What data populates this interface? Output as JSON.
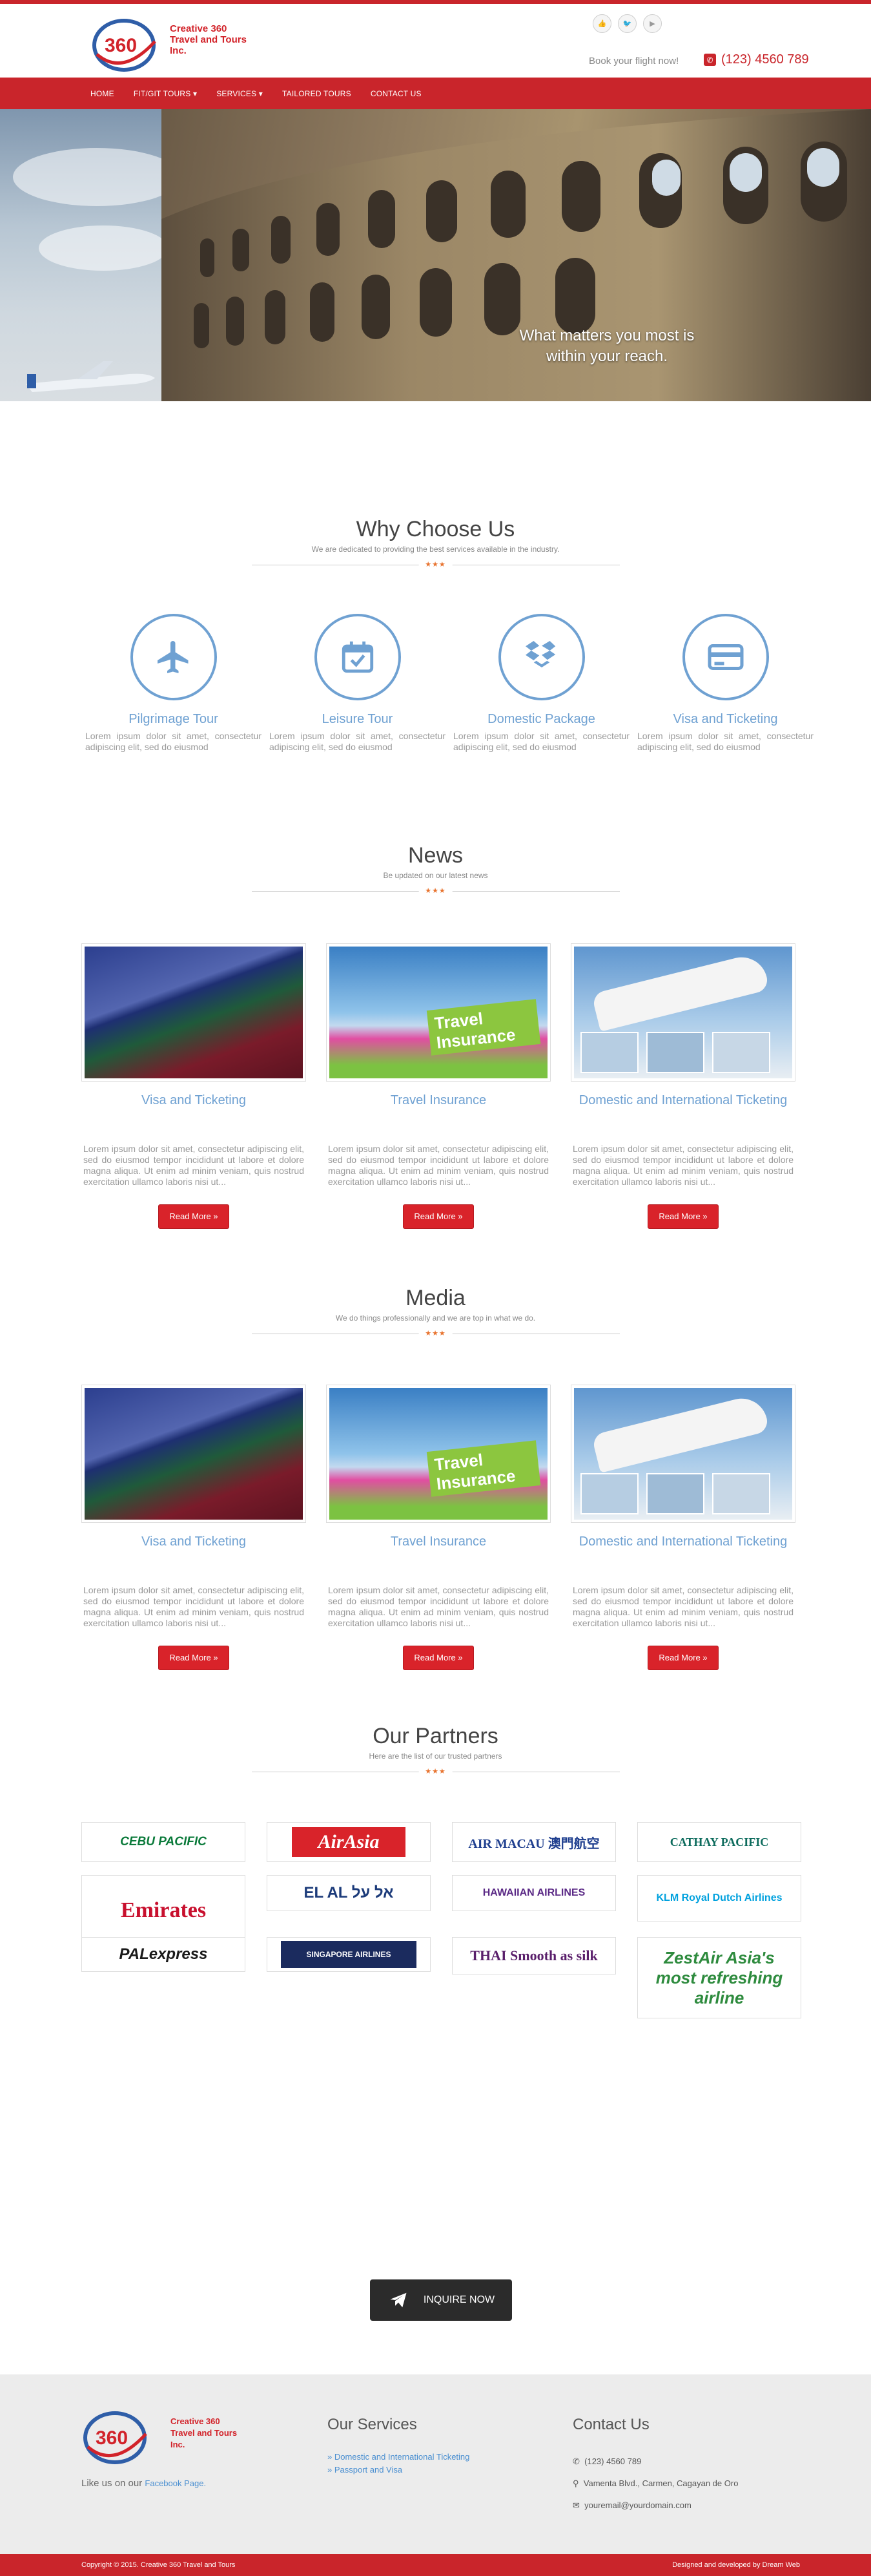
{
  "brand": {
    "name_line1": "Creative 360",
    "name_line2": "Travel and Tours",
    "name_line3": "Inc.",
    "logo_number": "360"
  },
  "header": {
    "book_text": "Book your flight now!",
    "phone": "(123) 4560 789",
    "social": [
      "thumbs-up-icon",
      "twitter-icon",
      "youtube-icon"
    ]
  },
  "nav": [
    "HOME",
    "FIT/GIT TOURS ▾",
    "SERVICES ▾",
    "TAILORED TOURS",
    "CONTACT US"
  ],
  "hero": {
    "tagline": "What matters you most is within your reach."
  },
  "why": {
    "title": "Why Choose Us",
    "subtitle": "We are dedicated to providing the best services available in the industry.",
    "features": [
      {
        "icon": "airplane-icon",
        "title": "Pilgrimage Tour",
        "text": "Lorem ipsum dolor sit amet, consectetur adipiscing elit, sed do eiusmod"
      },
      {
        "icon": "calendar-check-icon",
        "title": "Leisure Tour",
        "text": "Lorem ipsum dolor sit amet, consectetur adipiscing elit, sed do eiusmod"
      },
      {
        "icon": "dropbox-icon",
        "title": "Domestic Package",
        "text": "Lorem ipsum dolor sit amet, consectetur adipiscing elit, sed do eiusmod"
      },
      {
        "icon": "credit-card-icon",
        "title": "Visa and Ticketing",
        "text": "Lorem ipsum dolor sit amet, consectetur adipiscing elit, sed do eiusmod"
      }
    ]
  },
  "news": {
    "title": "News",
    "subtitle": "Be updated on our latest news",
    "items": [
      {
        "title": "Visa and Ticketing",
        "image": "passports",
        "text": "Lorem ipsum dolor sit amet, consectetur adipiscing elit, sed do eiusmod tempor incididunt ut labore et dolore magna aliqua. Ut enim ad minim veniam, quis nostrud exercitation ullamco laboris nisi ut...",
        "button": "Read More »"
      },
      {
        "title": "Travel Insurance",
        "image": "travel-insurance",
        "text": "Lorem ipsum dolor sit amet, consectetur adipiscing elit, sed do eiusmod tempor incididunt ut labore et dolore magna aliqua. Ut enim ad minim veniam, quis nostrud exercitation ullamco laboris nisi ut...",
        "button": "Read More »"
      },
      {
        "title": "Domestic and International Ticketing",
        "image": "airplanes",
        "text": "Lorem ipsum dolor sit amet, consectetur adipiscing elit, sed do eiusmod tempor incididunt ut labore et dolore magna aliqua. Ut enim ad minim veniam, quis nostrud exercitation ullamco laboris nisi ut...",
        "button": "Read More »"
      }
    ]
  },
  "media": {
    "title": "Media",
    "subtitle": "We do things professionally and we are top in what we do.",
    "items": [
      {
        "title": "Visa and Ticketing",
        "image": "passports",
        "text": "Lorem ipsum dolor sit amet, consectetur adipiscing elit, sed do eiusmod tempor incididunt ut labore et dolore magna aliqua. Ut enim ad minim veniam, quis nostrud exercitation ullamco laboris nisi ut...",
        "button": "Read More »"
      },
      {
        "title": "Travel Insurance",
        "image": "travel-insurance",
        "text": "Lorem ipsum dolor sit amet, consectetur adipiscing elit, sed do eiusmod tempor incididunt ut labore et dolore magna aliqua. Ut enim ad minim veniam, quis nostrud exercitation ullamco laboris nisi ut...",
        "button": "Read More »"
      },
      {
        "title": "Domestic and International Ticketing",
        "image": "airplanes",
        "text": "Lorem ipsum dolor sit amet, consectetur adipiscing elit, sed do eiusmod tempor incididunt ut labore et dolore magna aliqua. Ut enim ad minim veniam, quis nostrud exercitation ullamco laboris nisi ut...",
        "button": "Read More »"
      }
    ]
  },
  "partners": {
    "title": "Our Partners",
    "subtitle": "Here are the list of our trusted partners",
    "logos": [
      {
        "name": "CEBU PACIFIC",
        "color": "#0a7a3a"
      },
      {
        "name": "AirAsia",
        "color": "#d9232a"
      },
      {
        "name": "AIR MACAU 澳門航空",
        "color": "#1f3f8f"
      },
      {
        "name": "CATHAY PACIFIC",
        "color": "#0c6b5c"
      },
      {
        "name": "Emirates",
        "color": "#c8102e"
      },
      {
        "name": "EL AL אל על",
        "color": "#1c3b7a"
      },
      {
        "name": "HAWAIIAN AIRLINES",
        "color": "#5b2a86"
      },
      {
        "name": "KLM Royal Dutch Airlines",
        "color": "#00a1de"
      },
      {
        "name": "PALexpress",
        "color": "#1a1a1a"
      },
      {
        "name": "SINGAPORE AIRLINES",
        "color": "#f2b600"
      },
      {
        "name": "THAI Smooth as silk",
        "color": "#5a1f6b"
      },
      {
        "name": "ZestAir Asia's most refreshing airline",
        "color": "#2e8b3e"
      }
    ]
  },
  "inquire": {
    "label": "INQUIRE NOW"
  },
  "footer": {
    "like_prefix": "Like us on our",
    "like_link": "Facebook Page.",
    "services_title": "Our Services",
    "services": [
      "» Domestic and International Ticketing",
      "» Passport and Visa"
    ],
    "contact_title": "Contact Us",
    "contact": [
      {
        "icon": "phone-icon",
        "text": "(123) 4560 789"
      },
      {
        "icon": "map-marker-icon",
        "text": "Vamenta Blvd., Carmen, Cagayan de Oro"
      },
      {
        "icon": "envelope-icon",
        "text": "youremail@yourdomain.com"
      }
    ],
    "copyright": "Copyright © 2015. Creative 360 Travel and Tours",
    "credit": "Designed and developed by Dream Web"
  },
  "colors": {
    "brand_red": "#c9252b",
    "accent_blue": "#6fa1d2",
    "star_orange": "#e8732e"
  }
}
